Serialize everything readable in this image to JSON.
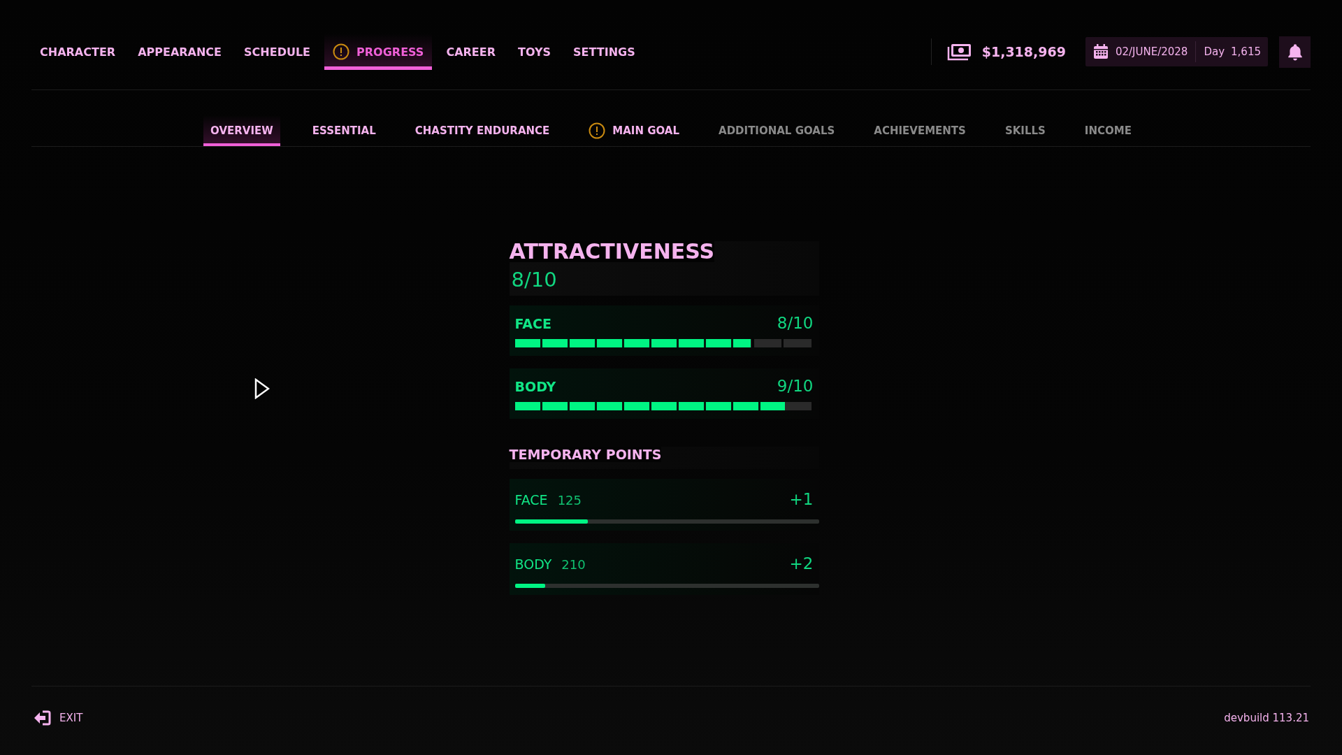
{
  "main_tabs": [
    {
      "label": "CHARACTER",
      "selected": false,
      "alert": false
    },
    {
      "label": "APPEARANCE",
      "selected": false,
      "alert": false
    },
    {
      "label": "SCHEDULE",
      "selected": false,
      "alert": false
    },
    {
      "label": "PROGRESS",
      "selected": true,
      "alert": true
    },
    {
      "label": "CAREER",
      "selected": false,
      "alert": false
    },
    {
      "label": "TOYS",
      "selected": false,
      "alert": false
    },
    {
      "label": "SETTINGS",
      "selected": false,
      "alert": false
    }
  ],
  "money": "$1,318,969",
  "date": {
    "date": "02/JUNE/2028",
    "day_label": "Day",
    "day": "1,615"
  },
  "sub_tabs": [
    {
      "label": "OVERVIEW",
      "selected": true,
      "alert": false,
      "disabled": false
    },
    {
      "label": "ESSENTIAL",
      "selected": false,
      "alert": false,
      "disabled": false
    },
    {
      "label": "CHASTITY ENDURANCE",
      "selected": false,
      "alert": false,
      "disabled": false
    },
    {
      "label": "MAIN GOAL",
      "selected": false,
      "alert": true,
      "disabled": false
    },
    {
      "label": "ADDITIONAL GOALS",
      "selected": false,
      "alert": false,
      "disabled": true
    },
    {
      "label": "ACHIEVEMENTS",
      "selected": false,
      "alert": false,
      "disabled": true
    },
    {
      "label": "SKILLS",
      "selected": false,
      "alert": false,
      "disabled": true
    },
    {
      "label": "INCOME",
      "selected": false,
      "alert": false,
      "disabled": true
    }
  ],
  "attractiveness": {
    "title": "ATTRACTIVENESS",
    "score": "8/10",
    "stats": [
      {
        "name": "FACE",
        "score": "8/10",
        "level": 0.79
      },
      {
        "name": "BODY",
        "score": "9/10",
        "level": 0.905
      }
    ]
  },
  "temporary_points": {
    "title": "TEMPORARY POINTS",
    "items": [
      {
        "name": "FACE",
        "points": "125",
        "bonus": "+1",
        "level": 0.24
      },
      {
        "name": "BODY",
        "points": "210",
        "bonus": "+2",
        "level": 0.1
      }
    ]
  },
  "footer": {
    "exit": "EXIT",
    "build": "devbuild 113.21"
  }
}
